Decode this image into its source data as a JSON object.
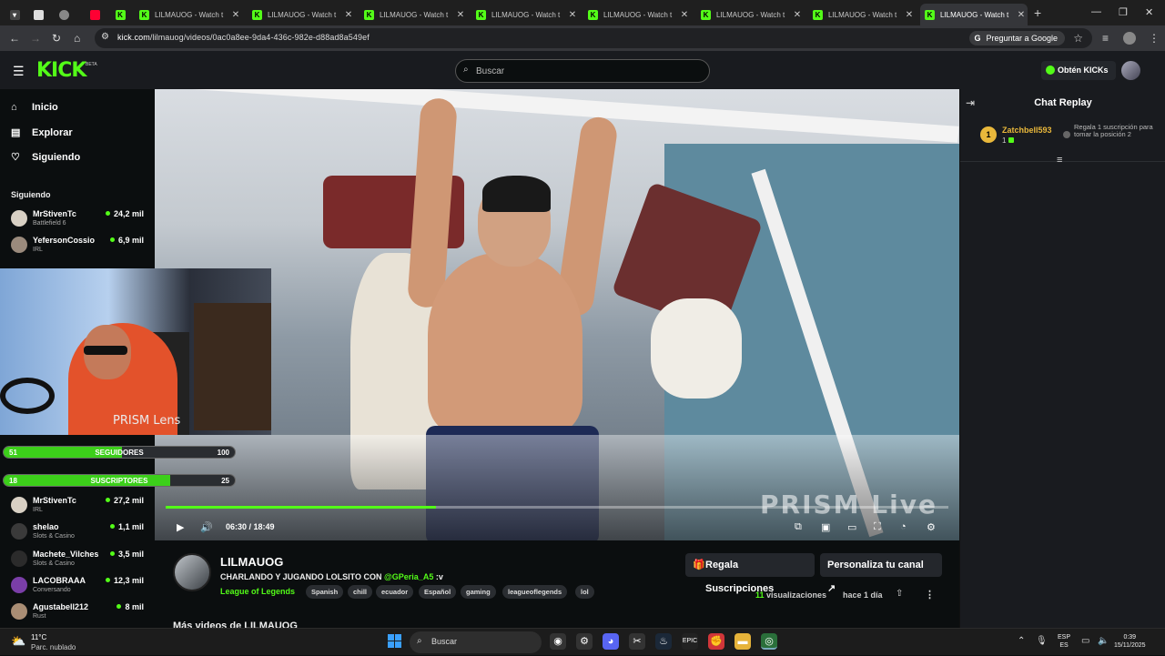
{
  "browser": {
    "tabs": [
      {
        "title": ""
      },
      {
        "title": ""
      },
      {
        "title": ""
      },
      {
        "title": ""
      },
      {
        "title": ""
      },
      {
        "title": "LILMAUOG - Watch t"
      },
      {
        "title": "LILMAUOG - Watch t"
      },
      {
        "title": "LILMAUOG - Watch t"
      },
      {
        "title": "LILMAUOG - Watch t"
      },
      {
        "title": "LILMAUOG - Watch t"
      },
      {
        "title": "LILMAUOG - Watch t"
      },
      {
        "title": "LILMAUOG - Watch t"
      },
      {
        "title": "LILMAUOG - Watch t"
      }
    ],
    "url_domain": "kick.com",
    "url_path": "/lilmauog/videos/0ac0a8ee-9da4-436c-982e-d88ad8a549ef",
    "google_button": "Preguntar a Google"
  },
  "header": {
    "logo": "KICK",
    "beta": "BETA",
    "search_placeholder": "Buscar",
    "kicks_button": "Obtén KICKs"
  },
  "sidebar": {
    "nav": [
      {
        "label": "Inicio",
        "icon": "home-icon"
      },
      {
        "label": "Explorar",
        "icon": "browse-icon"
      },
      {
        "label": "Siguiendo",
        "icon": "heart-icon"
      }
    ],
    "following_heading": "Siguiendo",
    "following": [
      {
        "name": "MrStivenTc",
        "category": "Battlefield 6",
        "viewers": "24,2 mil",
        "color": "#d8d0c4"
      },
      {
        "name": "YefersonCossio",
        "category": "IRL",
        "viewers": "6,9 mil",
        "color": "#9a8a7c"
      }
    ],
    "recommended": [
      {
        "name": "MrStivenTc",
        "category": "IRL",
        "viewers": "27,2 mil",
        "color": "#d8d0c4"
      },
      {
        "name": "shelao",
        "category": "Slots & Casino",
        "viewers": "1,1 mil",
        "color": "#3a3a3a"
      },
      {
        "name": "Machete_Vilches",
        "category": "Slots & Casino",
        "viewers": "3,5 mil",
        "color": "#2b2b2b"
      },
      {
        "name": "LACOBRAAA",
        "category": "Conversando",
        "viewers": "12,3 mil",
        "color": "#7a3ea8"
      },
      {
        "name": "Agustabell212",
        "category": "Rust",
        "viewers": "8 mil",
        "color": "#a98d74"
      }
    ]
  },
  "overlay": {
    "brand": "PRISM Lens",
    "followers": {
      "current": "51",
      "label": "SEGUIDORES",
      "goal": "100",
      "progress": 0.51
    },
    "subs": {
      "current": "18",
      "label": "SUSCRIPTORES",
      "goal": "25",
      "progress": 0.72
    }
  },
  "player": {
    "watermark": "PRISM Live",
    "time": "06:30 / 18:49",
    "progress": 0.345
  },
  "chat": {
    "title": "Chat Replay",
    "leader_rank": "1",
    "leader_name": "Zatchbell593",
    "leader_count": "1",
    "leader_gift": "Regala 1 suscripción para tomar la posición 2"
  },
  "channel": {
    "name": "LILMAUOG",
    "title": "CHARLANDO Y JUGANDO LOLSITO CON ",
    "mention": "@GPeria_A5",
    "title_suffix": " :v",
    "category": "League of Legends",
    "tags": [
      "Spanish",
      "chill",
      "ecuador",
      "Español",
      "gaming",
      "leagueoflegends",
      "lol"
    ],
    "gift_button": "Regala Suscripciones",
    "customize_button": "Personaliza tu canal",
    "views_count": "11",
    "views_label": " visualizaciones",
    "ago": "hace 1 día",
    "more_videos": "Más videos de LILMAUOG"
  },
  "taskbar": {
    "temp": "11°C",
    "weather": "Parc. nublado",
    "search": "Buscar",
    "lang1": "ESP",
    "lang2": "ES",
    "time": "0:39",
    "date": "15/11/2025"
  },
  "colors": {
    "kick_green": "#53fc18",
    "gold": "#e9b83b"
  }
}
